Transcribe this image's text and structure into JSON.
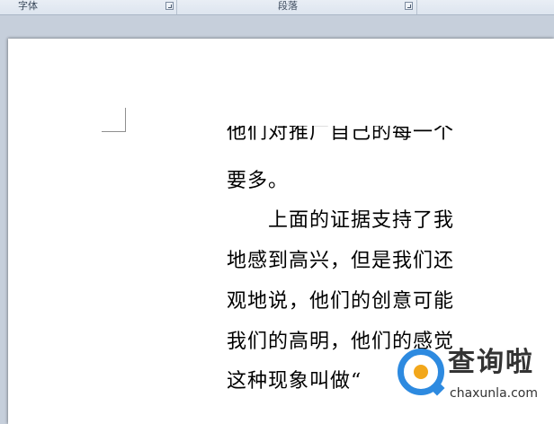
{
  "ribbon": {
    "font_group_label": "字体",
    "paragraph_group_label": "段落"
  },
  "document": {
    "lines": [
      "他们对推广自己的每一个",
      "要多。",
      "　　上面的证据支持了我",
      "地感到高兴，但是我们还",
      "观地说，他们的创意可能",
      "我们的高明，他们的感觉",
      "这种现象叫做“"
    ]
  },
  "watermark": {
    "title": "查询啦",
    "subtitle": "chaxunla.com"
  }
}
